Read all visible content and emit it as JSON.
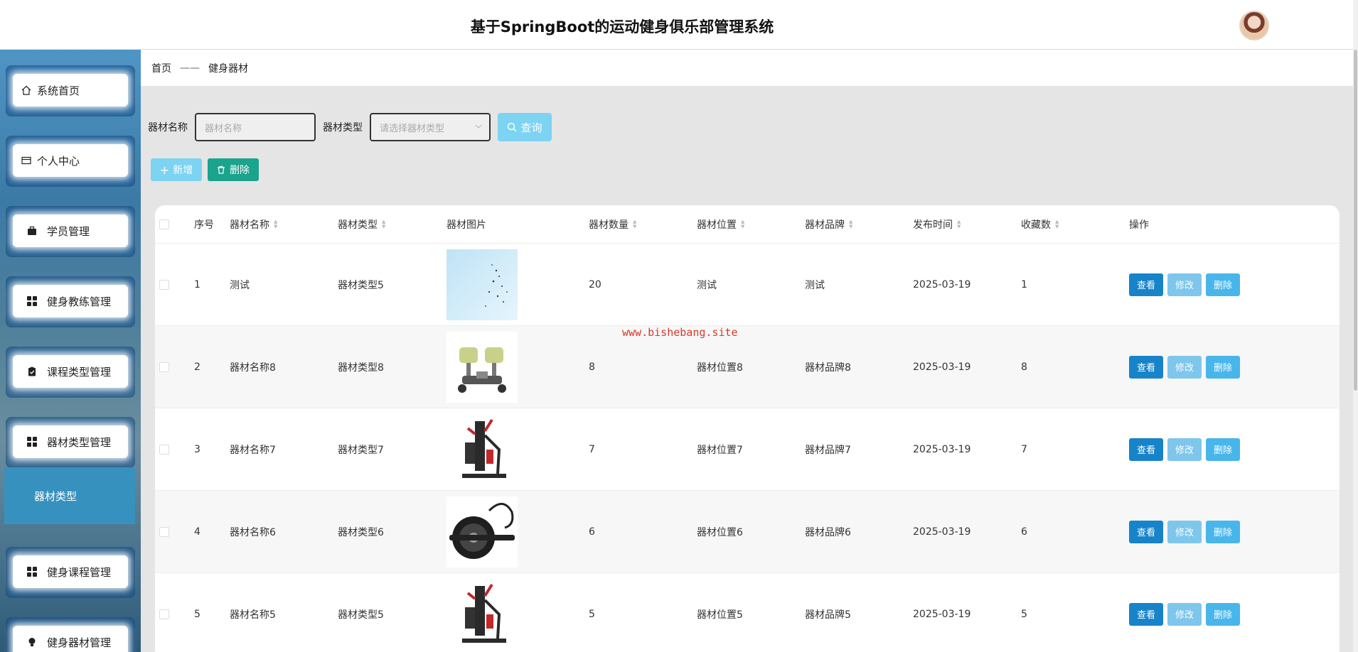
{
  "header": {
    "title": "基于SpringBoot的运动健身俱乐部管理系统"
  },
  "sidebar": {
    "items": [
      {
        "label": "系统首页",
        "icon": "home-icon"
      },
      {
        "label": "个人中心",
        "icon": "card-icon"
      },
      {
        "label": "学员管理",
        "icon": "briefcase-icon"
      },
      {
        "label": "健身教练管理",
        "icon": "grid-icon"
      },
      {
        "label": "课程类型管理",
        "icon": "clipboard-icon"
      },
      {
        "label": "器材类型管理",
        "icon": "grid-icon"
      },
      {
        "label": "健身课程管理",
        "icon": "grid-icon"
      },
      {
        "label": "健身器材管理",
        "icon": "bulb-icon"
      }
    ],
    "submenu": {
      "label": "器材类型"
    }
  },
  "breadcrumb": {
    "home": "首页",
    "separator": "——",
    "current": "健身器材"
  },
  "search": {
    "name_label": "器材名称",
    "name_placeholder": "器材名称",
    "type_label": "器材类型",
    "type_placeholder": "请选择器材类型",
    "query_label": "查询"
  },
  "actions": {
    "add_label": "新增",
    "delete_label": "删除"
  },
  "table": {
    "columns": [
      "序号",
      "器材名称",
      "器材类型",
      "器材图片",
      "器材数量",
      "器材位置",
      "器材品牌",
      "发布时间",
      "收藏数",
      "操作"
    ],
    "rows": [
      {
        "index": "1",
        "name": "测试",
        "type": "器材类型5",
        "image": "sky",
        "quantity": "20",
        "location": "测试",
        "brand": "测试",
        "date": "2025-03-19",
        "favorites": "1"
      },
      {
        "index": "2",
        "name": "器材名称8",
        "type": "器材类型8",
        "image": "stepper",
        "quantity": "8",
        "location": "器材位置8",
        "brand": "器材品牌8",
        "date": "2025-03-19",
        "favorites": "8"
      },
      {
        "index": "3",
        "name": "器材名称7",
        "type": "器材类型7",
        "image": "machine",
        "quantity": "7",
        "location": "器材位置7",
        "brand": "器材品牌7",
        "date": "2025-03-19",
        "favorites": "7"
      },
      {
        "index": "4",
        "name": "器材名称6",
        "type": "器材类型6",
        "image": "wheel",
        "quantity": "6",
        "location": "器材位置6",
        "brand": "器材品牌6",
        "date": "2025-03-19",
        "favorites": "6"
      },
      {
        "index": "5",
        "name": "器材名称5",
        "type": "器材类型5",
        "image": "machine",
        "quantity": "5",
        "location": "器材位置5",
        "brand": "器材品牌5",
        "date": "2025-03-19",
        "favorites": "5"
      }
    ],
    "row_actions": {
      "view": "查看",
      "edit": "修改",
      "delete": "删除"
    }
  },
  "watermark": "www.bishebang.site"
}
